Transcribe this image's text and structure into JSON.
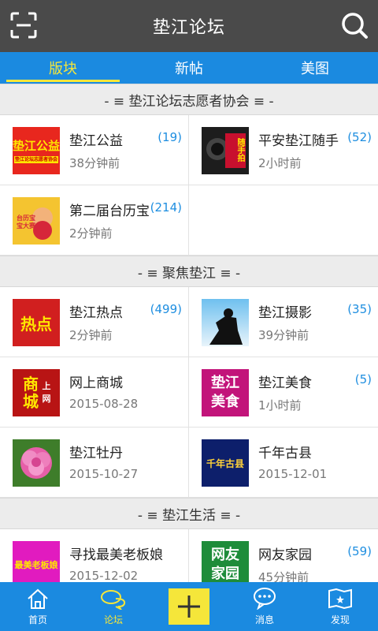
{
  "header": {
    "title": "垫江论坛"
  },
  "tabs": [
    {
      "label": "版块"
    },
    {
      "label": "新帖"
    },
    {
      "label": "美图"
    }
  ],
  "sections": [
    {
      "title": "- ≡ 垫江论坛志愿者协会 ≡ -",
      "items": [
        {
          "name": "垫江公益",
          "count": "(19)",
          "time": "38分钟前",
          "thumb_text": "垫江公益",
          "thumb_sub": "垫江论坛志愿者协会"
        },
        {
          "name": "平安垫江随手",
          "count": "(52)",
          "time": "2小时前",
          "thumb_text": "随手拍"
        },
        {
          "name": "第二届台历宝",
          "count": "(214)",
          "time": "2分钟前",
          "thumb_text": "台历宝宝大赛"
        }
      ]
    },
    {
      "title": "- ≡ 聚焦垫江 ≡ -",
      "items": [
        {
          "name": "垫江热点",
          "count": "(499)",
          "time": "2分钟前",
          "thumb_text": "热点"
        },
        {
          "name": "垫江摄影",
          "count": "(35)",
          "time": "39分钟前"
        },
        {
          "name": "网上商城",
          "count": "",
          "time": "2015-08-28",
          "thumb_text": "商城",
          "thumb_sub": "上网"
        },
        {
          "name": "垫江美食",
          "count": "(5)",
          "time": "1小时前",
          "thumb_text": "垫江美食"
        },
        {
          "name": "垫江牡丹",
          "count": "",
          "time": "2015-10-27"
        },
        {
          "name": "千年古县",
          "count": "",
          "time": "2015-12-01",
          "thumb_text": "千年古县"
        }
      ]
    },
    {
      "title": "- ≡ 垫江生活 ≡ -",
      "items": [
        {
          "name": "寻找最美老板娘",
          "count": "",
          "time": "2015-12-02",
          "thumb_text": "最美老板娘"
        },
        {
          "name": "网友家园",
          "count": "(59)",
          "time": "45分钟前",
          "thumb_text": "网友家园"
        }
      ]
    }
  ],
  "bottom_nav": [
    {
      "label": "首页"
    },
    {
      "label": "论坛"
    },
    {
      "label": "消息"
    },
    {
      "label": "发现"
    }
  ],
  "colors": {
    "accent": "#1b8ae0",
    "highlight": "#f5e63a",
    "titlebar": "#4a4a4a",
    "count": "#1e8ee0"
  }
}
